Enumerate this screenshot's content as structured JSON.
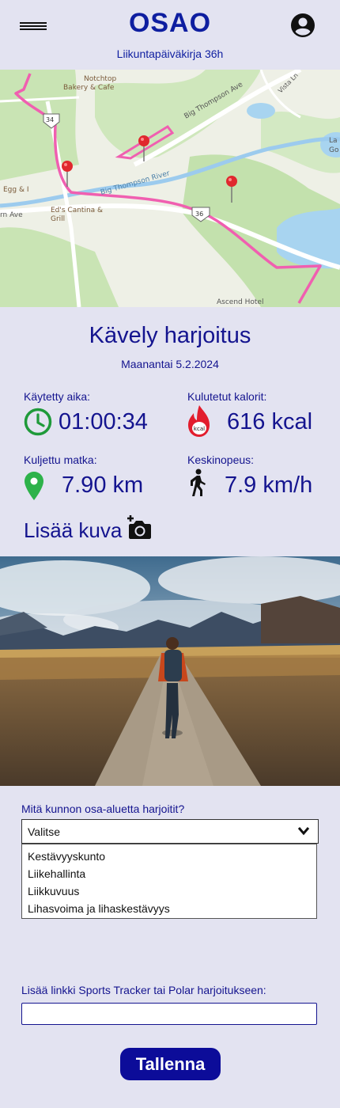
{
  "header": {
    "title": "OSAO",
    "subtitle": "Liikuntapäiväkirja 36h",
    "menu_icon": "hamburger-icon",
    "account_icon": "account-circle-icon"
  },
  "map": {
    "places": [
      "Notchtop",
      "Bakery & Cafe",
      "Big Thompson Ave",
      "Vista Ln",
      "Big Thompson River",
      "Egg & I",
      "Ed's Cantina &",
      "Grill",
      "Ascend Hotel",
      "La",
      "Go",
      "rn Ave"
    ],
    "road_shields": [
      "34",
      "36"
    ],
    "route_color": "#f05fb0"
  },
  "workout": {
    "title": "Kävely harjoitus",
    "date": "Maanantai 5.2.2024"
  },
  "stats": {
    "time": {
      "label": "Käytetty aika:",
      "value": "01:00:34",
      "icon": "clock-icon"
    },
    "calories": {
      "label": "Kulutetut kalorit:",
      "value": "616 kcal",
      "icon_text": "kcal",
      "icon": "flame-icon"
    },
    "distance": {
      "label": "Kuljettu matka:",
      "value": "7.90 km",
      "icon": "location-pin-icon"
    },
    "speed": {
      "label": "Keskinopeus:",
      "value": "7.9 km/h",
      "icon": "walking-icon"
    }
  },
  "add_photo": {
    "label": "Lisää kuva",
    "icon": "add-photo-icon"
  },
  "fitness_area": {
    "question": "Mitä kunnon osa-aluetta harjoitit?",
    "selected": "Valitse",
    "options": [
      "Kestävyyskunto",
      "Liikehallinta",
      "Liikkuvuus",
      "Lihasvoima ja lihaskestävyys"
    ]
  },
  "link": {
    "label": "Lisää linkki Sports Tracker tai Polar harjoitukseen:",
    "value": ""
  },
  "save_button": "Tallenna",
  "colors": {
    "background": "#e3e3f1",
    "primary": "#0e1ea0",
    "button": "#0c0c99",
    "clock": "#1f9a3a",
    "pin": "#2db24a",
    "flame": "#e21d2d"
  }
}
